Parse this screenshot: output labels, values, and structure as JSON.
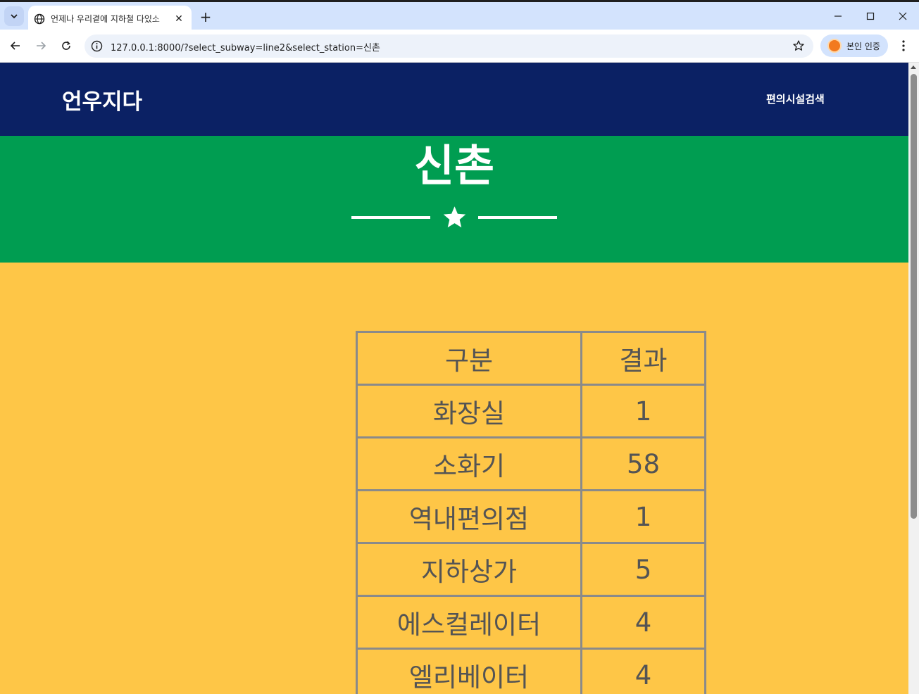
{
  "browser": {
    "tab_title": "언제나 우리곁에 지하철 다있소",
    "tab_close": "✕",
    "new_tab": "+",
    "url": "127.0.0.1:8000/?select_subway=line2&select_station=신촌",
    "profile_label": "본인 인증",
    "icons": [
      "tab-search-icon",
      "globe-icon",
      "close-icon",
      "new-tab-icon",
      "minimize-icon",
      "maximize-icon",
      "window-close-icon",
      "back-icon",
      "forward-icon",
      "reload-icon",
      "info-icon",
      "bookmark-star-icon",
      "kebab-menu-icon"
    ]
  },
  "site": {
    "brand": "언우지다",
    "nav_link": "편의시설검색"
  },
  "hero": {
    "station_name": "신촌"
  },
  "colors": {
    "navbar": "#0b2164",
    "hero": "#009d51",
    "page_background": "#fec647",
    "table_border": "#8a8a8a",
    "table_text": "#545454"
  },
  "table": {
    "headers": [
      "구분",
      "결과"
    ],
    "rows": [
      {
        "label": "화장실",
        "value": "1"
      },
      {
        "label": "소화기",
        "value": "58"
      },
      {
        "label": "역내편의점",
        "value": "1"
      },
      {
        "label": "지하상가",
        "value": "5"
      },
      {
        "label": "에스컬레이터",
        "value": "4"
      },
      {
        "label": "엘리베이터",
        "value": "4"
      }
    ]
  }
}
